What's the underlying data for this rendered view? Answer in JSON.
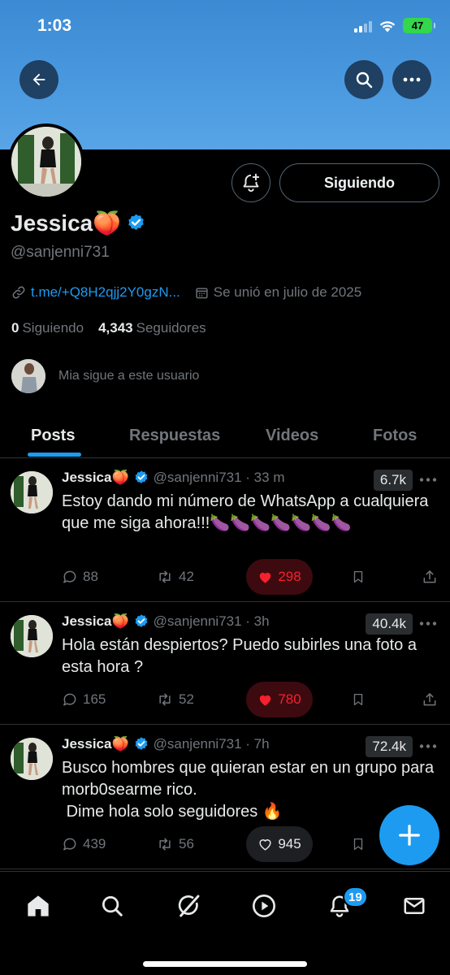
{
  "status_bar": {
    "time": "1:03",
    "battery": "47"
  },
  "profile": {
    "name": "Jessica🍑",
    "handle": "@sanjenni731",
    "follow_button": "Siguiendo",
    "link": "t.me/+Q8H2qjj2Y0gzN...",
    "joined": "Se unió en julio de 2025",
    "following_count": "0",
    "following_label": "Siguiendo",
    "followers_count": "4,343",
    "followers_label": "Seguidores",
    "followed_by": "Mia sigue a este usuario"
  },
  "tabs": [
    "Posts",
    "Respuestas",
    "Videos",
    "Fotos"
  ],
  "posts": [
    {
      "name": "Jessica🍑",
      "meta": "@sanjenni731 · 33 m",
      "views": "6.7k",
      "text": "Estoy dando mi número de WhatsApp a cualquiera que me siga ahora!!!🍆🍆🍆🍆🍆🍆🍆",
      "replies": "88",
      "reposts": "42",
      "likes": "298",
      "liked": true
    },
    {
      "name": "Jessica🍑",
      "meta": "@sanjenni731 · 3h",
      "views": "40.4k",
      "text": "Hola están despiertos? Puedo subirles una foto a esta hora ?",
      "replies": "165",
      "reposts": "52",
      "likes": "780",
      "liked": true
    },
    {
      "name": "Jessica🍑",
      "meta": "@sanjenni731 · 7h",
      "views": "72.4k",
      "text": "Busco hombres que quieran estar en un grupo para morb0searme rico.\n Dime hola solo seguidores 🔥",
      "replies": "439",
      "reposts": "56",
      "likes": "945",
      "liked": false
    }
  ],
  "nav": {
    "notifications_badge": "19"
  },
  "colors": {
    "accent": "#1d9bf0",
    "like": "#f4212e",
    "banner": "#4b9ae0",
    "verified": "#1d9bf0"
  },
  "icons": [
    "back-arrow-icon",
    "search-icon",
    "more-icon",
    "bell-plus-icon",
    "verified-badge-icon",
    "link-icon",
    "calendar-icon",
    "reply-icon",
    "repost-icon",
    "heart-icon",
    "bookmark-icon",
    "share-icon",
    "compose-plus-icon",
    "home-icon",
    "explore-icon",
    "grok-icon",
    "video-icon",
    "notifications-icon",
    "messages-icon"
  ]
}
